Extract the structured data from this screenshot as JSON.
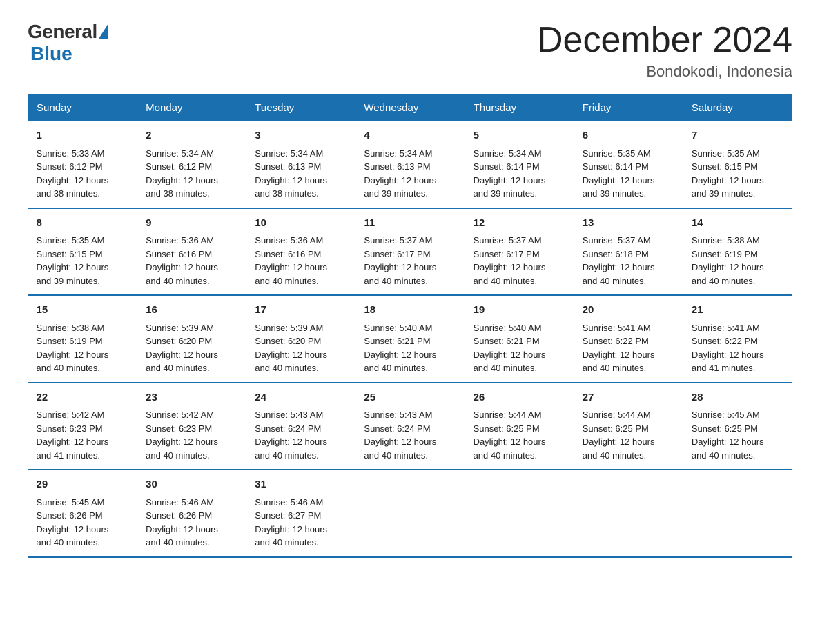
{
  "header": {
    "logo_general": "General",
    "logo_blue": "Blue",
    "title": "December 2024",
    "subtitle": "Bondokodi, Indonesia"
  },
  "days_of_week": [
    "Sunday",
    "Monday",
    "Tuesday",
    "Wednesday",
    "Thursday",
    "Friday",
    "Saturday"
  ],
  "weeks": [
    [
      {
        "day": "1",
        "sunrise": "5:33 AM",
        "sunset": "6:12 PM",
        "daylight": "12 hours and 38 minutes."
      },
      {
        "day": "2",
        "sunrise": "5:34 AM",
        "sunset": "6:12 PM",
        "daylight": "12 hours and 38 minutes."
      },
      {
        "day": "3",
        "sunrise": "5:34 AM",
        "sunset": "6:13 PM",
        "daylight": "12 hours and 38 minutes."
      },
      {
        "day": "4",
        "sunrise": "5:34 AM",
        "sunset": "6:13 PM",
        "daylight": "12 hours and 39 minutes."
      },
      {
        "day": "5",
        "sunrise": "5:34 AM",
        "sunset": "6:14 PM",
        "daylight": "12 hours and 39 minutes."
      },
      {
        "day": "6",
        "sunrise": "5:35 AM",
        "sunset": "6:14 PM",
        "daylight": "12 hours and 39 minutes."
      },
      {
        "day": "7",
        "sunrise": "5:35 AM",
        "sunset": "6:15 PM",
        "daylight": "12 hours and 39 minutes."
      }
    ],
    [
      {
        "day": "8",
        "sunrise": "5:35 AM",
        "sunset": "6:15 PM",
        "daylight": "12 hours and 39 minutes."
      },
      {
        "day": "9",
        "sunrise": "5:36 AM",
        "sunset": "6:16 PM",
        "daylight": "12 hours and 40 minutes."
      },
      {
        "day": "10",
        "sunrise": "5:36 AM",
        "sunset": "6:16 PM",
        "daylight": "12 hours and 40 minutes."
      },
      {
        "day": "11",
        "sunrise": "5:37 AM",
        "sunset": "6:17 PM",
        "daylight": "12 hours and 40 minutes."
      },
      {
        "day": "12",
        "sunrise": "5:37 AM",
        "sunset": "6:17 PM",
        "daylight": "12 hours and 40 minutes."
      },
      {
        "day": "13",
        "sunrise": "5:37 AM",
        "sunset": "6:18 PM",
        "daylight": "12 hours and 40 minutes."
      },
      {
        "day": "14",
        "sunrise": "5:38 AM",
        "sunset": "6:19 PM",
        "daylight": "12 hours and 40 minutes."
      }
    ],
    [
      {
        "day": "15",
        "sunrise": "5:38 AM",
        "sunset": "6:19 PM",
        "daylight": "12 hours and 40 minutes."
      },
      {
        "day": "16",
        "sunrise": "5:39 AM",
        "sunset": "6:20 PM",
        "daylight": "12 hours and 40 minutes."
      },
      {
        "day": "17",
        "sunrise": "5:39 AM",
        "sunset": "6:20 PM",
        "daylight": "12 hours and 40 minutes."
      },
      {
        "day": "18",
        "sunrise": "5:40 AM",
        "sunset": "6:21 PM",
        "daylight": "12 hours and 40 minutes."
      },
      {
        "day": "19",
        "sunrise": "5:40 AM",
        "sunset": "6:21 PM",
        "daylight": "12 hours and 40 minutes."
      },
      {
        "day": "20",
        "sunrise": "5:41 AM",
        "sunset": "6:22 PM",
        "daylight": "12 hours and 40 minutes."
      },
      {
        "day": "21",
        "sunrise": "5:41 AM",
        "sunset": "6:22 PM",
        "daylight": "12 hours and 41 minutes."
      }
    ],
    [
      {
        "day": "22",
        "sunrise": "5:42 AM",
        "sunset": "6:23 PM",
        "daylight": "12 hours and 41 minutes."
      },
      {
        "day": "23",
        "sunrise": "5:42 AM",
        "sunset": "6:23 PM",
        "daylight": "12 hours and 40 minutes."
      },
      {
        "day": "24",
        "sunrise": "5:43 AM",
        "sunset": "6:24 PM",
        "daylight": "12 hours and 40 minutes."
      },
      {
        "day": "25",
        "sunrise": "5:43 AM",
        "sunset": "6:24 PM",
        "daylight": "12 hours and 40 minutes."
      },
      {
        "day": "26",
        "sunrise": "5:44 AM",
        "sunset": "6:25 PM",
        "daylight": "12 hours and 40 minutes."
      },
      {
        "day": "27",
        "sunrise": "5:44 AM",
        "sunset": "6:25 PM",
        "daylight": "12 hours and 40 minutes."
      },
      {
        "day": "28",
        "sunrise": "5:45 AM",
        "sunset": "6:25 PM",
        "daylight": "12 hours and 40 minutes."
      }
    ],
    [
      {
        "day": "29",
        "sunrise": "5:45 AM",
        "sunset": "6:26 PM",
        "daylight": "12 hours and 40 minutes."
      },
      {
        "day": "30",
        "sunrise": "5:46 AM",
        "sunset": "6:26 PM",
        "daylight": "12 hours and 40 minutes."
      },
      {
        "day": "31",
        "sunrise": "5:46 AM",
        "sunset": "6:27 PM",
        "daylight": "12 hours and 40 minutes."
      },
      {
        "day": "",
        "sunrise": "",
        "sunset": "",
        "daylight": ""
      },
      {
        "day": "",
        "sunrise": "",
        "sunset": "",
        "daylight": ""
      },
      {
        "day": "",
        "sunrise": "",
        "sunset": "",
        "daylight": ""
      },
      {
        "day": "",
        "sunrise": "",
        "sunset": "",
        "daylight": ""
      }
    ]
  ],
  "labels": {
    "sunrise": "Sunrise:",
    "sunset": "Sunset:",
    "daylight": "Daylight:"
  }
}
